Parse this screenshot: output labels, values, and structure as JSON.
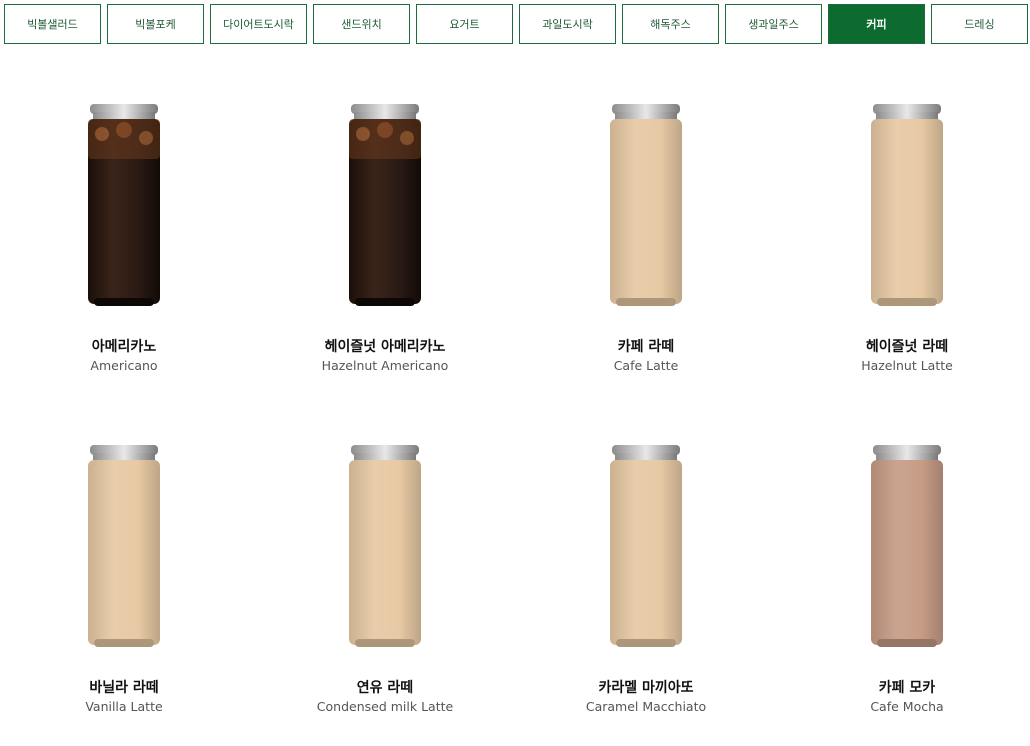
{
  "tabs": [
    {
      "label": "빅볼샐러드",
      "active": false
    },
    {
      "label": "빅볼포케",
      "active": false
    },
    {
      "label": "다이어트도시락",
      "active": false
    },
    {
      "label": "샌드위치",
      "active": false
    },
    {
      "label": "요거트",
      "active": false
    },
    {
      "label": "과일도시락",
      "active": false
    },
    {
      "label": "해독주스",
      "active": false
    },
    {
      "label": "생과일주스",
      "active": false
    },
    {
      "label": "커피",
      "active": true
    },
    {
      "label": "드레싱",
      "active": false
    }
  ],
  "products": [
    {
      "name_ko": "아메리카노",
      "name_en": "Americano",
      "can_color": "#2a1a14",
      "icon": "coffee-can-icon"
    },
    {
      "name_ko": "헤이즐넛 아메리카노",
      "name_en": "Hazelnut Americano",
      "can_color": "#2a1a14",
      "icon": "coffee-can-icon"
    },
    {
      "name_ko": "카페 라떼",
      "name_en": "Cafe Latte",
      "can_color": "#e7c9a4",
      "icon": "coffee-can-icon"
    },
    {
      "name_ko": "헤이즐넛 라떼",
      "name_en": "Hazelnut Latte",
      "can_color": "#e7c9a4",
      "icon": "coffee-can-icon"
    },
    {
      "name_ko": "바닐라 라떼",
      "name_en": "Vanilla Latte",
      "can_color": "#e7c9a4",
      "icon": "coffee-can-icon"
    },
    {
      "name_ko": "연유 라떼",
      "name_en": "Condensed milk Latte",
      "can_color": "#e7c9a4",
      "icon": "coffee-can-icon"
    },
    {
      "name_ko": "카라멜 마끼아또",
      "name_en": "Caramel Macchiato",
      "can_color": "#e7c9a4",
      "icon": "coffee-can-icon"
    },
    {
      "name_ko": "카페 모카",
      "name_en": "Cafe Mocha",
      "can_color": "#c79c86",
      "icon": "coffee-can-icon"
    }
  ],
  "colors": {
    "accent": "#0d6b2f",
    "tab_border": "#1e6b3a"
  }
}
